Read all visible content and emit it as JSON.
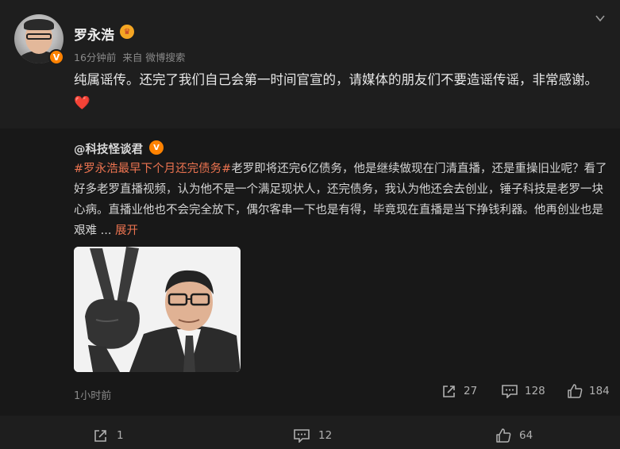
{
  "post": {
    "author": "罗永浩",
    "time": "16分钟前",
    "source": "来自 微博搜索",
    "text": "纯属谣传。还完了我们自己会第一时间官宣的，请媒体的朋友们不要造谣传谣，非常感谢。",
    "emoji": "❤️",
    "verified_badge": "V",
    "crown_icon": "crown-icon"
  },
  "repost": {
    "author": "@科技怪谈君",
    "verified_badge": "V",
    "hashtag": "#罗永浩最早下个月还完债务#",
    "text": "老罗即将还完6亿债务，他是继续做现在门清直播，还是重操旧业呢？看了好多老罗直播视频，认为他不是一个满足现状人，还完债务，我认为他还会去创业，锤子科技是老罗一块心病。直播业他也不会完全放下，偶尔客串一下也是有得，毕竟现在直播是当下挣钱利器。他再创业也是艰难  ...",
    "expand_label": "展开",
    "time": "1小时前",
    "reposts": "27",
    "comments": "128",
    "likes": "184"
  },
  "actions": {
    "reposts": "1",
    "comments": "12",
    "likes": "64"
  },
  "colors": {
    "background": "#1e1e1e",
    "repost_background": "#181818",
    "link": "#eb7350",
    "badge": "#ff8200",
    "muted": "#8a8a8a"
  }
}
